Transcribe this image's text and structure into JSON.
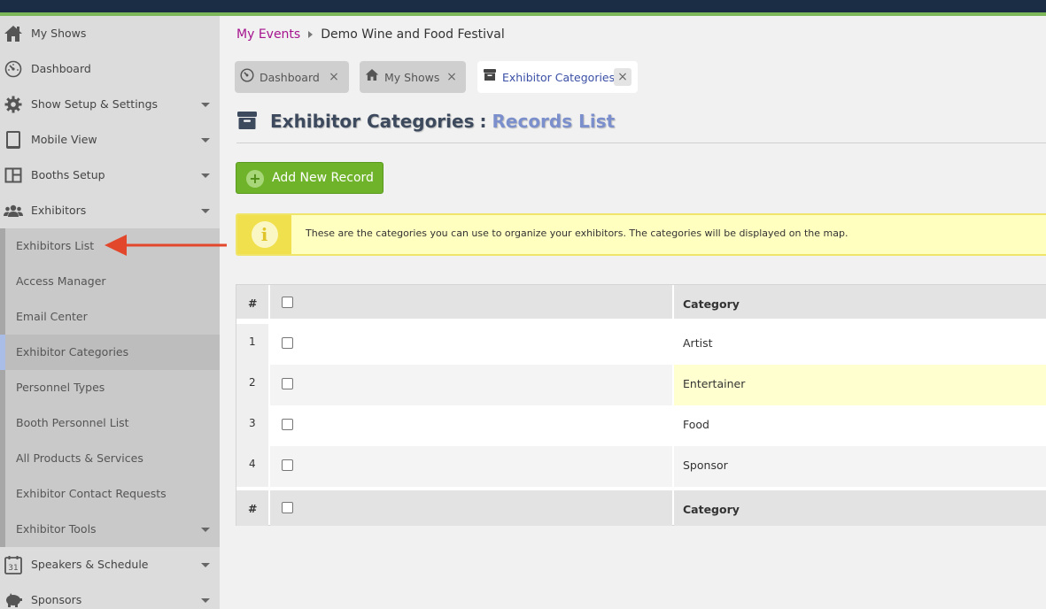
{
  "colors": {
    "topbar": "#1b2d44",
    "accent_stripe": "#7cb85a",
    "breadcrumb_link": "#a5138f",
    "add_button": "#6fb32a",
    "info_background": "#ffffc0",
    "annotation_arrow": "#e2472c"
  },
  "sidebar": {
    "items": [
      {
        "label": "My Shows",
        "icon": "home-icon"
      },
      {
        "label": "Dashboard",
        "icon": "dashboard-icon"
      },
      {
        "label": "Show Setup & Settings",
        "icon": "gear-icon"
      },
      {
        "label": "Mobile View",
        "icon": "tablet-icon"
      },
      {
        "label": "Booths Setup",
        "icon": "booths-icon"
      },
      {
        "label": "Exhibitors",
        "icon": "users-icon"
      }
    ],
    "exhibitors_sub": [
      {
        "label": "Exhibitors List"
      },
      {
        "label": "Access Manager"
      },
      {
        "label": "Email Center"
      },
      {
        "label": "Exhibitor Categories"
      },
      {
        "label": "Personnel Types"
      },
      {
        "label": "Booth Personnel List"
      },
      {
        "label": "All Products & Services"
      },
      {
        "label": "Exhibitor Contact Requests"
      },
      {
        "label": "Exhibitor Tools"
      }
    ],
    "bottom_items": [
      {
        "label": "Speakers & Schedule",
        "icon": "calendar-icon",
        "icon_text": "31"
      },
      {
        "label": "Sponsors",
        "icon": "piggy-bank-icon"
      }
    ]
  },
  "breadcrumb": {
    "link": "My Events",
    "current": "Demo Wine and Food Festival"
  },
  "tabs": [
    {
      "label": "Dashboard",
      "icon": "dashboard-icon",
      "close": "×"
    },
    {
      "label": "My Shows",
      "icon": "home-icon",
      "close": "×"
    },
    {
      "label": "Exhibitor Categories",
      "icon": "archive-box-icon",
      "close": "×"
    }
  ],
  "page_title": {
    "main": "Exhibitor Categories",
    "separator": ":",
    "sub": "Records List"
  },
  "add_button": {
    "label": "Add New Record",
    "icon_glyph": "+"
  },
  "info": {
    "icon_glyph": "i",
    "text": "These are the categories you can use to organize your exhibitors. The categories will be displayed on the map."
  },
  "table": {
    "columns": [
      "#",
      "Category"
    ],
    "rows": [
      {
        "num": "1",
        "category": "Artist"
      },
      {
        "num": "2",
        "category": "Entertainer"
      },
      {
        "num": "3",
        "category": "Food"
      },
      {
        "num": "4",
        "category": "Sponsor"
      }
    ]
  }
}
